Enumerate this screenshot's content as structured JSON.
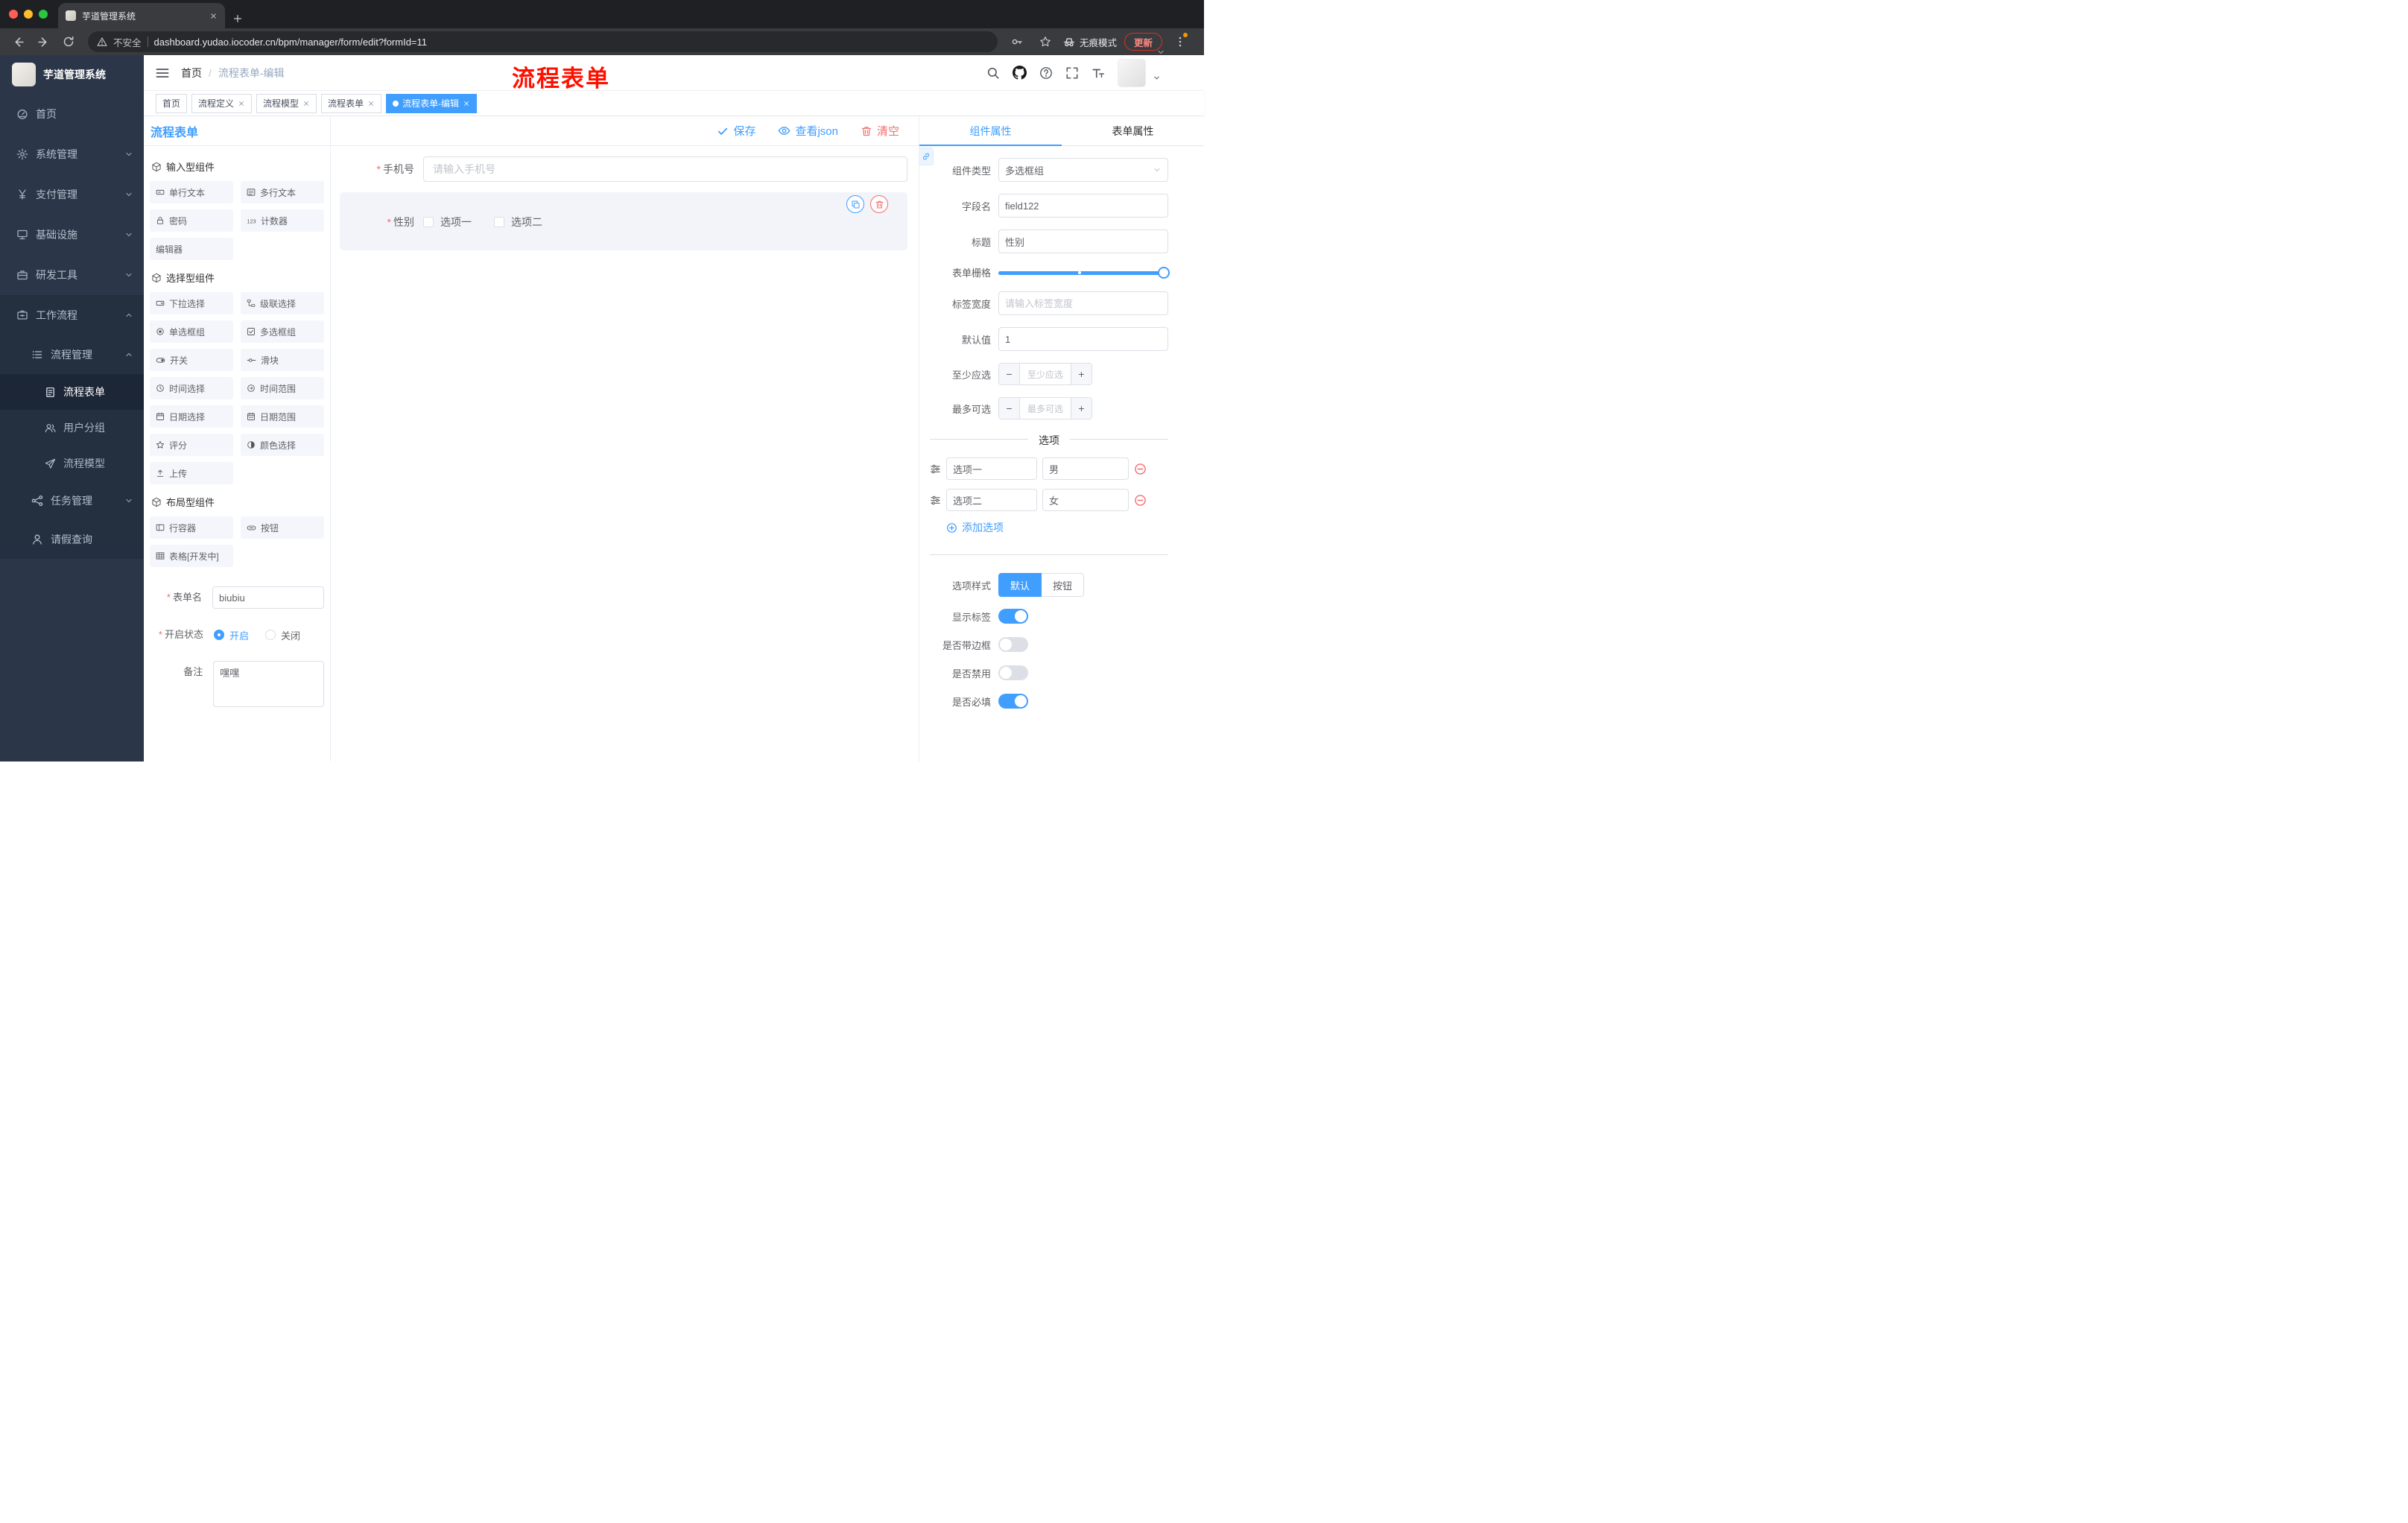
{
  "browser": {
    "tab_title": "芋道管理系统",
    "security": "不安全",
    "url": "dashboard.yudao.iocoder.cn/bpm/manager/form/edit?formId=11",
    "incognito": "无痕模式",
    "update": "更新"
  },
  "navbar": {
    "breadcrumb": [
      "首页",
      "流程表单-编辑"
    ],
    "annotation": "流程表单"
  },
  "sidebar": {
    "logo_title": "芋道管理系统",
    "items": [
      {
        "label": "首页"
      },
      {
        "label": "系统管理"
      },
      {
        "label": "支付管理"
      },
      {
        "label": "基础设施"
      },
      {
        "label": "研发工具"
      },
      {
        "label": "工作流程"
      }
    ],
    "process_mgmt": "流程管理",
    "process_children": [
      "流程表单",
      "用户分组",
      "流程模型"
    ],
    "task_mgmt": "任务管理",
    "leave_query": "请假查询"
  },
  "tags": {
    "items": [
      "首页",
      "流程定义",
      "流程模型",
      "流程表单",
      "流程表单-编辑"
    ]
  },
  "designer": {
    "title": "流程表单",
    "toolbar": {
      "save": "保存",
      "view_json": "查看json",
      "clear": "清空"
    },
    "groups": [
      {
        "title": "输入型组件",
        "items": [
          "单行文本",
          "多行文本",
          "密码",
          "计数器",
          "编辑器"
        ]
      },
      {
        "title": "选择型组件",
        "items": [
          "下拉选择",
          "级联选择",
          "单选框组",
          "多选框组",
          "开关",
          "滑块",
          "时间选择",
          "时间范围",
          "日期选择",
          "日期范围",
          "评分",
          "颜色选择",
          "上传"
        ]
      },
      {
        "title": "布局型组件",
        "items": [
          "行容器",
          "按钮",
          "表格[开发中]"
        ]
      }
    ],
    "form": {
      "name_label": "表单名",
      "name_value": "biubiu",
      "status_label": "开启状态",
      "status_on": "开启",
      "status_off": "关闭",
      "remark_label": "备注",
      "remark_value": "嘿嘿"
    }
  },
  "canvas": {
    "phone": {
      "label": "手机号",
      "placeholder": "请输入手机号"
    },
    "gender": {
      "label": "性别",
      "options": [
        "选项一",
        "选项二"
      ]
    }
  },
  "props": {
    "tabs": [
      "组件属性",
      "表单属性"
    ],
    "component_type_label": "组件类型",
    "component_type": "多选框组",
    "field_name_label": "字段名",
    "field_name": "field122",
    "title_label": "标题",
    "title_value": "性别",
    "grid_label": "表单栅格",
    "label_width_label": "标签宽度",
    "label_width_placeholder": "请输入标签宽度",
    "default_label": "默认值",
    "default_value": "1",
    "min_label": "至少应选",
    "min_placeholder": "至少应选",
    "max_label": "最多可选",
    "max_placeholder": "最多可选",
    "options_title": "选项",
    "options": [
      {
        "label": "选项一",
        "value": "男"
      },
      {
        "label": "选项二",
        "value": "女"
      }
    ],
    "add_option": "添加选项",
    "style_label": "选项样式",
    "style_options": [
      "默认",
      "按钮"
    ],
    "switches": [
      {
        "label": "显示标签",
        "on": true
      },
      {
        "label": "是否带边框",
        "on": false
      },
      {
        "label": "是否禁用",
        "on": false
      },
      {
        "label": "是否必填",
        "on": true
      }
    ]
  },
  "colors": {
    "primary": "#409eff",
    "danger": "#f56c6c",
    "annotation": "#fe1000",
    "sidebar_bg": "#2b3648"
  }
}
